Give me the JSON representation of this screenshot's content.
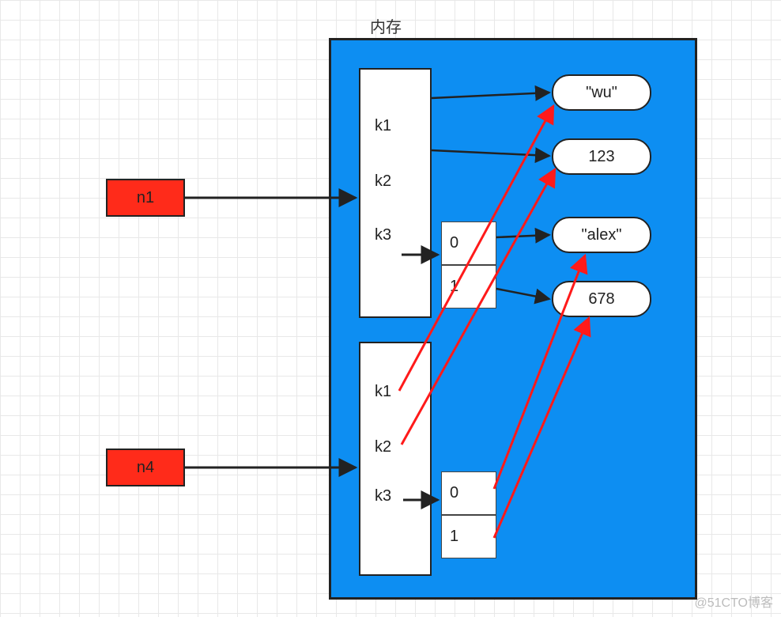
{
  "title": "内存",
  "vars": {
    "n1": "n1",
    "n4": "n4"
  },
  "dict1": {
    "k1": "k1",
    "k2": "k2",
    "k3": "k3"
  },
  "dict2": {
    "k1": "k1",
    "k2": "k2",
    "k3": "k3"
  },
  "list1": {
    "i0": "0",
    "i1": "1"
  },
  "list2": {
    "i0": "0",
    "i1": "1"
  },
  "values": {
    "wu": "\"wu\"",
    "v123": "123",
    "alex": "\"alex\"",
    "v678": "678"
  },
  "watermark": "@51CTO博客"
}
